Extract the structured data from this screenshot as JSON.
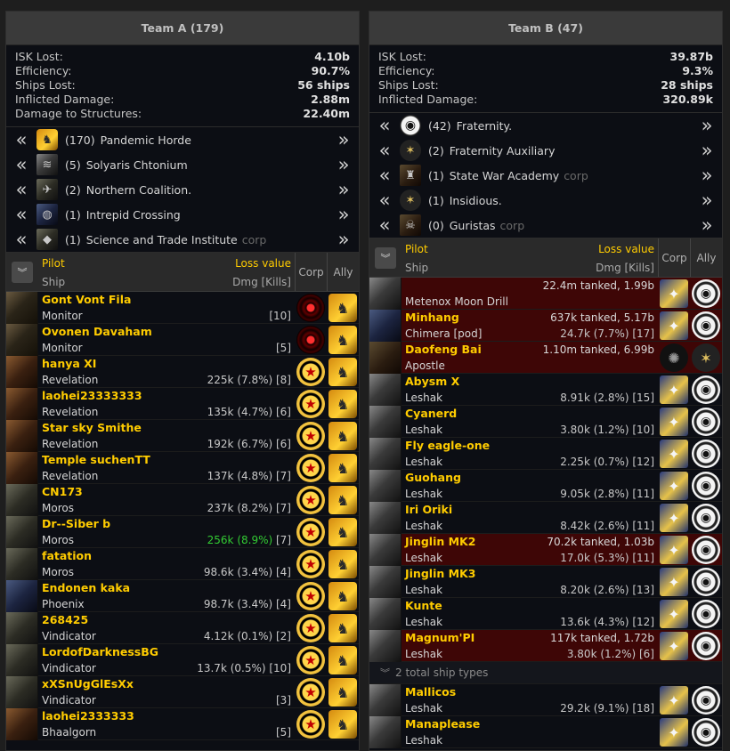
{
  "team_a": {
    "title": "Team A (179)",
    "stats": [
      {
        "label": "ISK Lost:",
        "value": "4.10b"
      },
      {
        "label": "Efficiency:",
        "value": "90.7%"
      },
      {
        "label": "Ships Lost:",
        "value": "56 ships"
      },
      {
        "label": "Inflicted Damage:",
        "value": "2.88m"
      },
      {
        "label": "Damage to Structures:",
        "value": "22.40m"
      }
    ],
    "groups": [
      {
        "count": "(170)",
        "name": "Pandemic Horde",
        "tag": "",
        "icon": "horde-icon"
      },
      {
        "count": "(5)",
        "name": "Solyaris Chtonium",
        "tag": "",
        "icon": "solyaris-icon"
      },
      {
        "count": "(2)",
        "name": "Northern Coalition.",
        "tag": "",
        "icon": "nc-icon"
      },
      {
        "count": "(1)",
        "name": "Intrepid Crossing",
        "tag": "",
        "icon": "intrepid-icon"
      },
      {
        "count": "(1)",
        "name": "Science and Trade Institute",
        "tag": "corp",
        "icon": "stimacorp-icon"
      }
    ],
    "table_header": {
      "pilot": "Pilot",
      "loss": "Loss value",
      "ship": "Ship",
      "dmg": "Dmg [Kills]",
      "corp": "Corp",
      "ally": "Ally"
    },
    "rows": [
      {
        "pilot": "Gont Vont Fila",
        "loss": "",
        "ship": "Monitor",
        "dmg": "[10]",
        "corp_icon": "vortex-corp-icon",
        "ally_icon": "horde-alliance-icon"
      },
      {
        "pilot": "Ovonen Davaham",
        "loss": "",
        "ship": "Monitor",
        "dmg": "[5]",
        "corp_icon": "vortex-corp-icon",
        "ally_icon": "horde-alliance-icon"
      },
      {
        "pilot": "hanya XI",
        "loss": "",
        "ship": "Revelation",
        "dmg": "225k (7.8%) [8]",
        "corp_icon": "star-corp-icon",
        "ally_icon": "horde-alliance-icon"
      },
      {
        "pilot": "laohei23333333",
        "loss": "",
        "ship": "Revelation",
        "dmg": "135k (4.7%) [6]",
        "corp_icon": "star-corp-icon",
        "ally_icon": "horde-alliance-icon"
      },
      {
        "pilot": "Star sky Smithe",
        "loss": "",
        "ship": "Revelation",
        "dmg": "192k (6.7%) [6]",
        "corp_icon": "star-corp-icon",
        "ally_icon": "horde-alliance-icon"
      },
      {
        "pilot": "Temple suchenTT",
        "loss": "",
        "ship": "Revelation",
        "dmg": "137k (4.8%) [7]",
        "corp_icon": "star-corp-icon",
        "ally_icon": "horde-alliance-icon"
      },
      {
        "pilot": "CN173",
        "loss": "",
        "ship": "Moros",
        "dmg": "237k (8.2%) [7]",
        "corp_icon": "star-corp-icon",
        "ally_icon": "horde-alliance-icon"
      },
      {
        "pilot": "Dr--Siber b",
        "loss": "",
        "ship": "Moros",
        "dmg": "256k (8.9%)",
        "dmg_kills": " [7]",
        "green": true,
        "corp_icon": "star-corp-icon",
        "ally_icon": "horde-alliance-icon"
      },
      {
        "pilot": "fatation",
        "loss": "",
        "ship": "Moros",
        "dmg": "98.6k (3.4%) [4]",
        "corp_icon": "star-corp-icon",
        "ally_icon": "horde-alliance-icon"
      },
      {
        "pilot": "Endonen kaka",
        "loss": "",
        "ship": "Phoenix",
        "dmg": "98.7k (3.4%) [4]",
        "corp_icon": "star-corp-icon",
        "ally_icon": "horde-alliance-icon"
      },
      {
        "pilot": "268425",
        "loss": "",
        "ship": "Vindicator",
        "dmg": "4.12k (0.1%) [2]",
        "corp_icon": "star-corp-icon",
        "ally_icon": "horde-alliance-icon"
      },
      {
        "pilot": "LordofDarknessBG",
        "loss": "",
        "ship": "Vindicator",
        "dmg": "13.7k (0.5%) [10]",
        "corp_icon": "star-corp-icon",
        "ally_icon": "horde-alliance-icon"
      },
      {
        "pilot": "xXSnUgGlEsXx",
        "loss": "",
        "ship": "Vindicator",
        "dmg": "[3]",
        "corp_icon": "star-corp-icon",
        "ally_icon": "horde-alliance-icon"
      },
      {
        "pilot": "laohei2333333",
        "loss": "",
        "ship": "Bhaalgorn",
        "dmg": "[5]",
        "corp_icon": "star-corp-icon",
        "ally_icon": "horde-alliance-icon"
      }
    ]
  },
  "team_b": {
    "title": "Team B (47)",
    "stats": [
      {
        "label": "ISK Lost:",
        "value": "39.87b"
      },
      {
        "label": "Efficiency:",
        "value": "9.3%"
      },
      {
        "label": "Ships Lost:",
        "value": "28 ships"
      },
      {
        "label": "Inflicted Damage:",
        "value": "320.89k"
      }
    ],
    "groups": [
      {
        "count": "(42)",
        "name": "Fraternity.",
        "tag": "",
        "icon": "fraternity-icon"
      },
      {
        "count": "(2)",
        "name": "Fraternity Auxiliary",
        "tag": "",
        "icon": "frat-aux-icon"
      },
      {
        "count": "(1)",
        "name": "State War Academy",
        "tag": "corp",
        "icon": "swa-icon"
      },
      {
        "count": "(1)",
        "name": "Insidious.",
        "tag": "",
        "icon": "insidious-icon"
      },
      {
        "count": "(0)",
        "name": "Guristas",
        "tag": "corp",
        "icon": "guristas-icon"
      }
    ],
    "table_header": {
      "pilot": "Pilot",
      "loss": "Loss value",
      "ship": "Ship",
      "dmg": "Dmg [Kills]",
      "corp": "Corp",
      "ally": "Ally"
    },
    "rows": [
      {
        "pilot": "",
        "loss": "22.4m tanked, 1.99b",
        "ship": "Metenox Moon Drill",
        "dmg": "",
        "red": true,
        "corp_icon": "frat-corp-icon",
        "ally_icon": "panda-alliance-icon"
      },
      {
        "pilot": "Minhang",
        "loss": "637k tanked, 5.17b",
        "ship": "Chimera",
        "ship_tag": "[pod]",
        "dmg": "24.7k (7.7%) [17]",
        "red": true,
        "corp_icon": "frat-corp-icon",
        "ally_icon": "panda-alliance-icon"
      },
      {
        "pilot": "Daofeng Bai",
        "loss": "1.10m tanked, 6.99b",
        "ship": "Apostle",
        "dmg": "",
        "red": true,
        "corp_icon": "dark-corp-icon",
        "ally_icon": "aux-star-alliance-icon"
      },
      {
        "pilot": "Abysm X",
        "loss": "",
        "ship": "Leshak",
        "dmg": "8.91k (2.8%) [15]",
        "corp_icon": "frat-corp-icon",
        "ally_icon": "panda-alliance-icon"
      },
      {
        "pilot": "Cyanerd",
        "loss": "",
        "ship": "Leshak",
        "dmg": "3.80k (1.2%) [10]",
        "corp_icon": "frat-corp-icon",
        "ally_icon": "panda-alliance-icon"
      },
      {
        "pilot": "Fly eagle-one",
        "loss": "",
        "ship": "Leshak",
        "dmg": "2.25k (0.7%) [12]",
        "corp_icon": "frat-corp-icon",
        "ally_icon": "panda-alliance-icon"
      },
      {
        "pilot": "Guohang",
        "loss": "",
        "ship": "Leshak",
        "dmg": "9.05k (2.8%) [11]",
        "corp_icon": "frat-corp-icon",
        "ally_icon": "panda-alliance-icon"
      },
      {
        "pilot": "Iri Oriki",
        "loss": "",
        "ship": "Leshak",
        "dmg": "8.42k (2.6%) [11]",
        "corp_icon": "frat-corp-icon",
        "ally_icon": "panda-alliance-icon"
      },
      {
        "pilot": "Jinglin MK2",
        "loss": "70.2k tanked, 1.03b",
        "ship": "Leshak",
        "dmg": "17.0k (5.3%) [11]",
        "red": true,
        "corp_icon": "frat-corp-icon",
        "ally_icon": "panda-alliance-icon"
      },
      {
        "pilot": "Jinglin MK3",
        "loss": "",
        "ship": "Leshak",
        "dmg": "8.20k (2.6%) [13]",
        "corp_icon": "frat-corp-icon",
        "ally_icon": "panda-alliance-icon"
      },
      {
        "pilot": "Kunte",
        "loss": "",
        "ship": "Leshak",
        "dmg": "13.6k (4.3%) [12]",
        "corp_icon": "frat-corp-icon",
        "ally_icon": "panda-alliance-icon"
      },
      {
        "pilot": "Magnum'PI",
        "loss": "117k tanked, 1.72b",
        "ship": "Leshak",
        "dmg": "3.80k (1.2%) [6]",
        "red": true,
        "corp_icon": "frat-corp-icon",
        "ally_icon": "panda-alliance-icon"
      }
    ],
    "summary": "2 total ship types",
    "rows_after": [
      {
        "pilot": "Mallicos",
        "loss": "",
        "ship": "Leshak",
        "dmg": "29.2k (9.1%) [18]",
        "corp_icon": "frat-corp-icon",
        "ally_icon": "panda-alliance-icon"
      },
      {
        "pilot": "Manaplease",
        "loss": "",
        "ship": "Leshak",
        "dmg": "",
        "corp_icon": "frat-corp-icon",
        "ally_icon": "panda-alliance-icon"
      }
    ]
  },
  "icons": {
    "chevron_left": "«",
    "chevron_right": "»",
    "toggle": "⌄⌄"
  }
}
